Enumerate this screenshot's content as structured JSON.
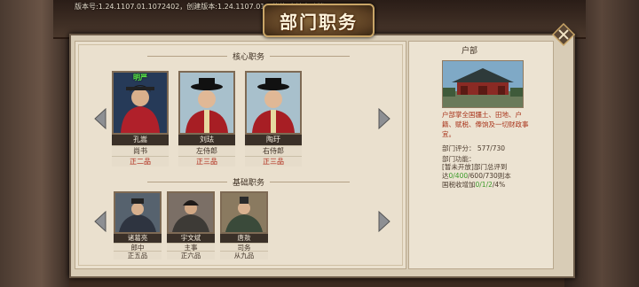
{
  "version_text": "版本号:1.24.1107.01.1072402，创建版本:1.24.1107.01，档位:本地自动档",
  "title": "部门职务",
  "core_section": "核心职务",
  "base_section": "基础职务",
  "core_officials": [
    {
      "tag": "明严",
      "name": "孔嵩",
      "post": "尚书",
      "rank": "正二品"
    },
    {
      "tag": "",
      "name": "刘珐",
      "post": "左侍郎",
      "rank": "正三品"
    },
    {
      "tag": "",
      "name": "陶玗",
      "post": "右侍郎",
      "rank": "正三品"
    }
  ],
  "base_officials": [
    {
      "name": "诸葛亮",
      "post": "郎中",
      "rank": "正五品"
    },
    {
      "name": "宇文斌",
      "post": "主事",
      "rank": "正六品"
    },
    {
      "name": "唐敖",
      "post": "司务",
      "rank": "从九品"
    }
  ],
  "info": {
    "title": "户部",
    "description": "户部掌全国疆土、田地、户籍、赋税、俸饷及一切财政事宜。",
    "score_label": "部门评分：",
    "score_value": "577/730",
    "func_label": "部门功能：",
    "func_line1": "[暂未开放]部门总评到",
    "func_line2a": "达",
    "func_line2b": "0/400",
    "func_line2c": "/600/730则本",
    "func_line3a": "国税收增加",
    "func_line3b": "0/1/2",
    "func_line3c": "/4%"
  },
  "colors": {
    "rank_red": "#b02818",
    "highlight_green": "#3a9a28",
    "tag_green": "#5ef04a"
  }
}
